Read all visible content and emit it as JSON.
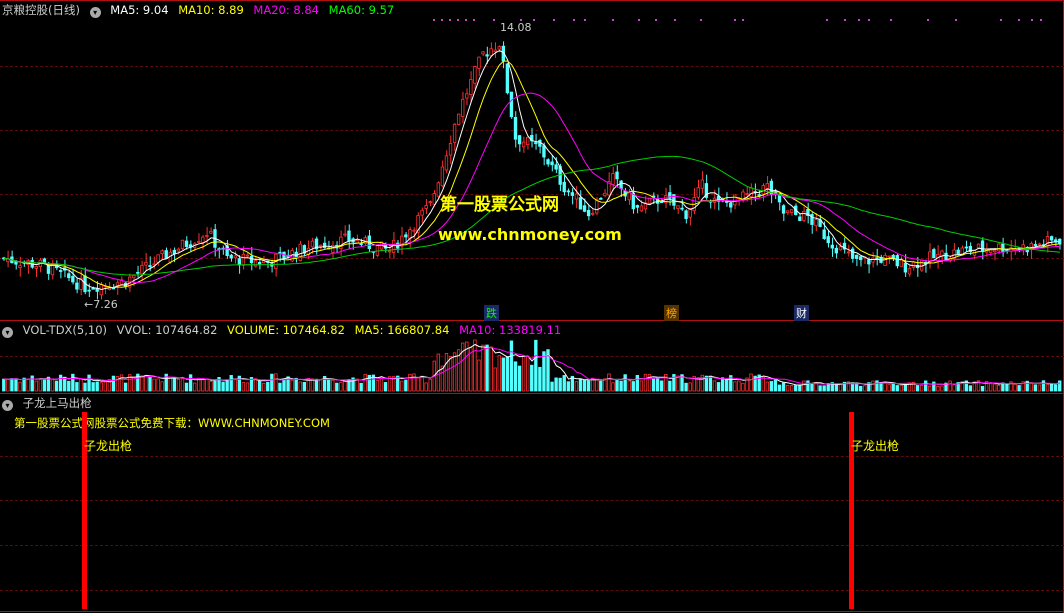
{
  "main_panel": {
    "stock_name": "京粮控股(日线)",
    "indicators": [
      {
        "label": "MA5: 9.04",
        "color": "#ffffff"
      },
      {
        "label": "MA10: 8.89",
        "color": "#ffff00"
      },
      {
        "label": "MA20: 8.84",
        "color": "#ff00ff"
      },
      {
        "label": "MA60: 9.57",
        "color": "#00ff00"
      }
    ],
    "high_label": "14.08",
    "low_label": "←7.26",
    "watermark_title": "第一股票公式网",
    "watermark_url": "www.chnmoney.com",
    "event_marks": [
      {
        "text": "跌",
        "color": "#00ff00",
        "bg": "#1a2a66"
      },
      {
        "text": "榜",
        "color": "#ffaa00",
        "bg": "#553300"
      },
      {
        "text": "财",
        "color": "#ffffff",
        "bg": "#1a2a66"
      }
    ],
    "colors": {
      "up": "#ff3030",
      "down": "#54ffff",
      "ma5": "#ffffff",
      "ma10": "#ffff00",
      "ma20": "#ff00ff",
      "ma60": "#00cc00"
    }
  },
  "volume_panel": {
    "title": "VOL-TDX(5,10)",
    "indicators": [
      {
        "label": "VVOL: 107464.82",
        "color": "#cccccc"
      },
      {
        "label": "VOLUME: 107464.82",
        "color": "#ffff00"
      },
      {
        "label": "MA5: 166807.84",
        "color": "#ffff00"
      },
      {
        "label": "MA10: 133819.11",
        "color": "#ff00ff"
      }
    ]
  },
  "signal_panel": {
    "title": "子龙上马出枪",
    "promo_text": "第一股票公式网股票公式免费下载：WWW.CHNMONEY.COM",
    "signals": [
      {
        "label": "子龙出枪"
      },
      {
        "label": "子龙出枪"
      }
    ],
    "signal_color": "#ff0000"
  }
}
